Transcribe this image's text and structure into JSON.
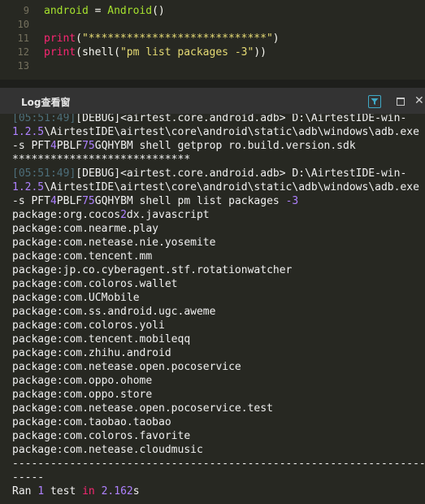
{
  "editor": {
    "lines": [
      {
        "num": "9",
        "text": "android = Android()"
      },
      {
        "num": "10",
        "text": ""
      },
      {
        "num": "11",
        "text": "print(\"****************************\")"
      },
      {
        "num": "12",
        "text": "print(shell(\"pm list packages -3\"))"
      },
      {
        "num": "13",
        "text": ""
      }
    ]
  },
  "log_panel": {
    "title": "Log查看窗",
    "icons": {
      "filter": "filter-icon",
      "float": "float-window-icon",
      "close": "close-icon"
    },
    "lines": {
      "ts1": "[05:51:49]",
      "debug1": "[DEBUG]<airtest.core.android.adb> D:\\AirtestIDE-win-",
      "path1a": "1.2.5\\AirtestIDE\\airtest\\core\\android\\static\\adb\\windows\\adb.exe",
      "cmd1": "-s PFT4PBLF75GQHYBM shell getprop ro.build.version.sdk",
      "stars": "****************************",
      "ts2": "[05:51:49]",
      "debug2": "[DEBUG]<airtest.core.android.adb> D:\\AirtestIDE-win-",
      "path2a": "1.2.5\\AirtestIDE\\airtest\\core\\android\\static\\adb\\windows\\adb.exe",
      "cmd2": "-s PFT4PBLF75GQHYBM shell pm list packages -3"
    },
    "packages": [
      "package:org.cocos2dx.javascript",
      "package:com.nearme.play",
      "package:com.netease.nie.yosemite",
      "package:com.tencent.mm",
      "package:jp.co.cyberagent.stf.rotationwatcher",
      "package:com.coloros.wallet",
      "package:com.UCMobile",
      "package:com.ss.android.ugc.aweme",
      "package:com.coloros.yoli",
      "package:com.tencent.mobileqq",
      "package:com.zhihu.android",
      "package:com.netease.open.pocoservice",
      "package:com.oppo.ohome",
      "package:com.oppo.store",
      "package:com.netease.open.pocoservice.test",
      "package:com.taobao.taobao",
      "package:com.coloros.favorite",
      "package:com.netease.cloudmusic"
    ],
    "separator": "----------------------------------------------------------------------",
    "separator_tail": "-----",
    "result": "Ran 1 test in 2.162s"
  },
  "colors": {
    "background": "#272822",
    "panel_header": "#333333",
    "number": "#ae81ff",
    "keyword": "#f92672",
    "string": "#e6db74"
  }
}
